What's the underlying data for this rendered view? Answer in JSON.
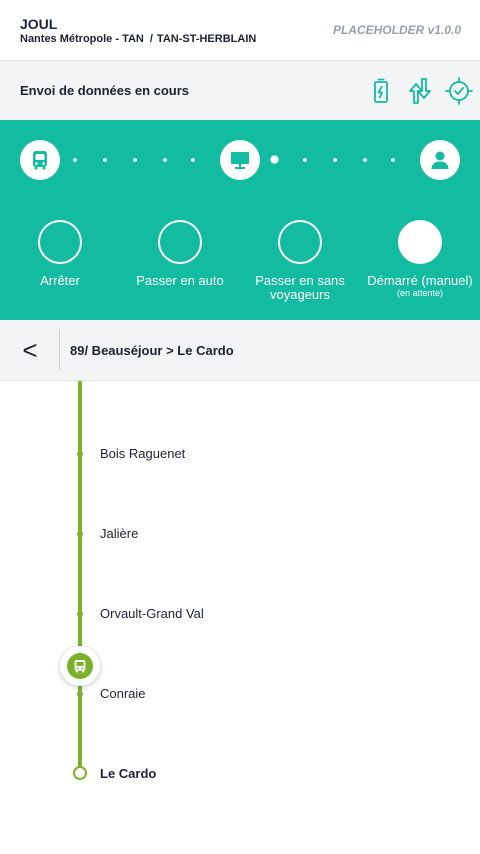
{
  "header": {
    "app_name": "JOUL",
    "network": "Nantes Métropole - TAN",
    "separator": "/",
    "site": "TAN-ST-HERBLAIN",
    "version": "PLACEHOLDER v1.0.0"
  },
  "status": {
    "text": "Envoi de données en cours",
    "icons": [
      "battery-charging-icon",
      "data-transfer-icon",
      "gps-target-icon"
    ]
  },
  "colors": {
    "teal": "#13bba0",
    "green": "#7ab22c",
    "dark": "#1c2330"
  },
  "connection": {
    "nodes": [
      "bus-icon",
      "monitor-icon",
      "user-icon"
    ]
  },
  "actions": [
    {
      "label": "Arrêter",
      "sub": "",
      "active": false
    },
    {
      "label": "Passer en auto",
      "sub": "",
      "active": false
    },
    {
      "label": "Passer en sans voyageurs",
      "sub": "",
      "active": false
    },
    {
      "label": "Démarré (manuel)",
      "sub": "(en attente)",
      "active": true
    }
  ],
  "route": {
    "back_label": "<",
    "title": "89/ Beauséjour > Le Cardo"
  },
  "stops": [
    {
      "name": "Bois Raguenet"
    },
    {
      "name": "Jalière"
    },
    {
      "name": "Orvault-Grand Val"
    },
    {
      "name": "Conraie"
    },
    {
      "name": "Le Cardo",
      "terminus": true
    }
  ]
}
